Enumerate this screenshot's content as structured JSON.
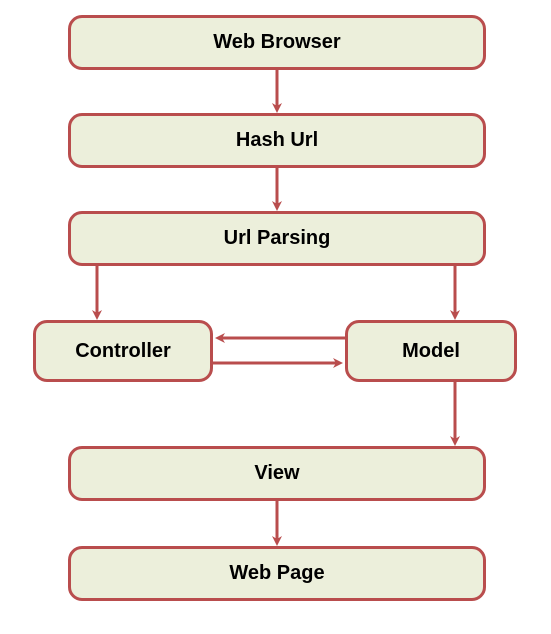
{
  "diagram": {
    "nodes": {
      "web_browser": "Web Browser",
      "hash_url": "Hash Url",
      "url_parsing": "Url Parsing",
      "controller": "Controller",
      "model": "Model",
      "view": "View",
      "web_page": "Web Page"
    },
    "edges": [
      {
        "from": "web_browser",
        "to": "hash_url"
      },
      {
        "from": "hash_url",
        "to": "url_parsing"
      },
      {
        "from": "url_parsing",
        "to": "controller"
      },
      {
        "from": "url_parsing",
        "to": "model"
      },
      {
        "from": "controller",
        "to": "model",
        "bidirectional": true
      },
      {
        "from": "model",
        "to": "view"
      },
      {
        "from": "view",
        "to": "web_page"
      }
    ],
    "colors": {
      "node_fill": "#ecefdb",
      "node_border": "#b94d4d",
      "arrow": "#b94d4d"
    }
  }
}
